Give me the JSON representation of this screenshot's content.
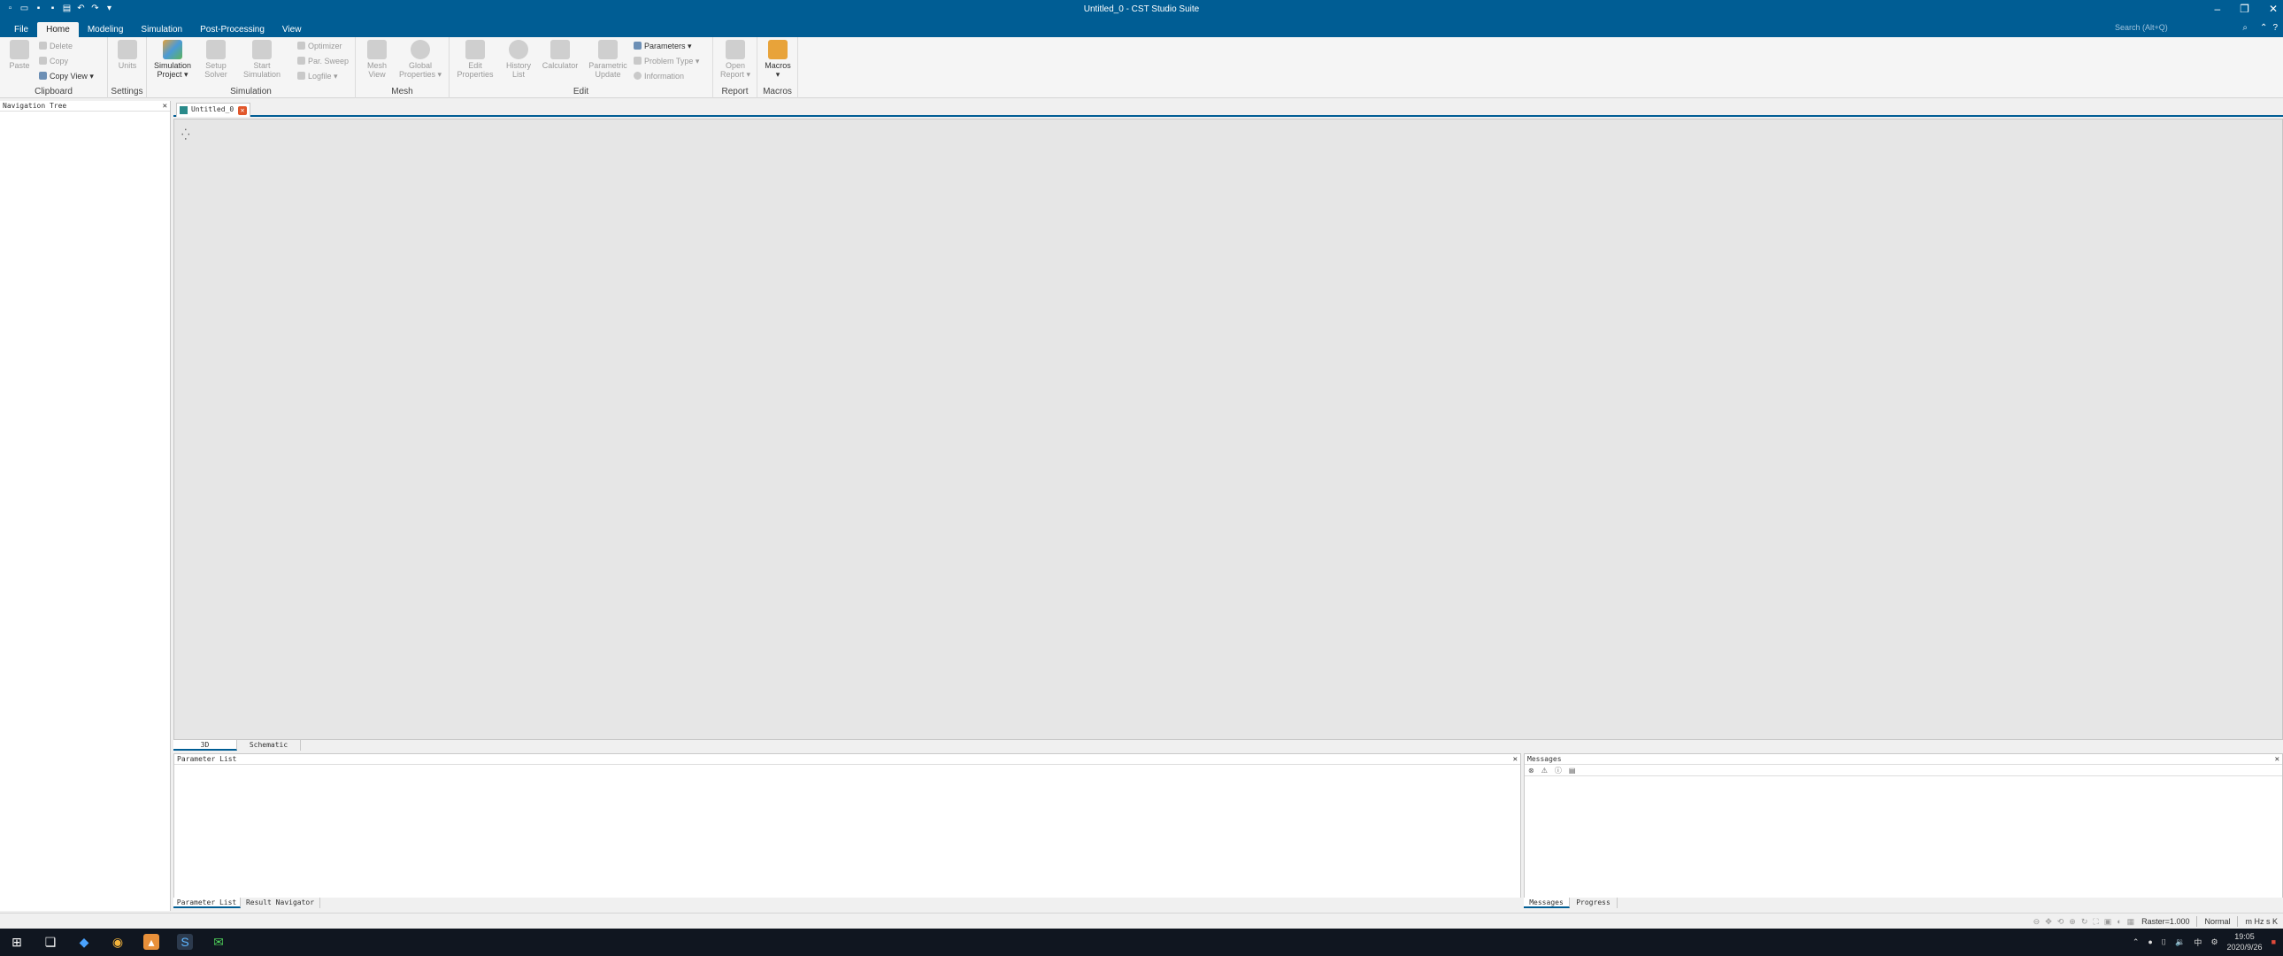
{
  "window": {
    "title": "Untitled_0 - CST Studio Suite"
  },
  "menu": {
    "tabs": [
      "File",
      "Home",
      "Modeling",
      "Simulation",
      "Post-Processing",
      "View"
    ],
    "active_tab": "Home",
    "search_placeholder": "Search (Alt+Q)"
  },
  "ribbon": {
    "clipboard": {
      "title": "Clipboard",
      "paste": "Paste",
      "delete": "Delete",
      "copy": "Copy",
      "copy_view": "Copy View"
    },
    "settings": {
      "title": "Settings",
      "units": "Units"
    },
    "simulation": {
      "title": "Simulation",
      "sim_project_1": "Simulation",
      "sim_project_2": "Project",
      "setup_1": "Setup",
      "setup_2": "Solver",
      "start_1": "Start",
      "start_2": "Simulation",
      "optimizer": "Optimizer",
      "par_sweep": "Par. Sweep",
      "logfile": "Logfile"
    },
    "mesh": {
      "title": "Mesh",
      "mesh_view_1": "Mesh",
      "mesh_view_2": "View",
      "global_1": "Global",
      "global_2": "Properties"
    },
    "edit": {
      "title": "Edit",
      "edit_props_1": "Edit",
      "edit_props_2": "Properties",
      "history_1": "History",
      "history_2": "List",
      "calculator": "Calculator",
      "param_update_1": "Parametric",
      "param_update_2": "Update",
      "parameters": "Parameters",
      "problem_type": "Problem Type",
      "information": "Information"
    },
    "report": {
      "title": "Report",
      "open_1": "Open",
      "open_2": "Report"
    },
    "macros": {
      "title": "Macros",
      "macros": "Macros"
    }
  },
  "nav_tree": {
    "title": "Navigation Tree"
  },
  "document": {
    "tab": "Untitled_0"
  },
  "view_tabs": [
    "3D",
    "Schematic"
  ],
  "parameter_list": {
    "title": "Parameter List"
  },
  "messages": {
    "title": "Messages"
  },
  "bottom_tabs_left": [
    "Parameter List",
    "Result Navigator"
  ],
  "bottom_tabs_right": [
    "Messages",
    "Progress"
  ],
  "status": {
    "raster": "Raster=1.000",
    "mode": "Normal",
    "units": "m  Hz  s  K"
  },
  "taskbar": {
    "time": "19:05",
    "date": "2020/9/26",
    "lang": "中"
  }
}
